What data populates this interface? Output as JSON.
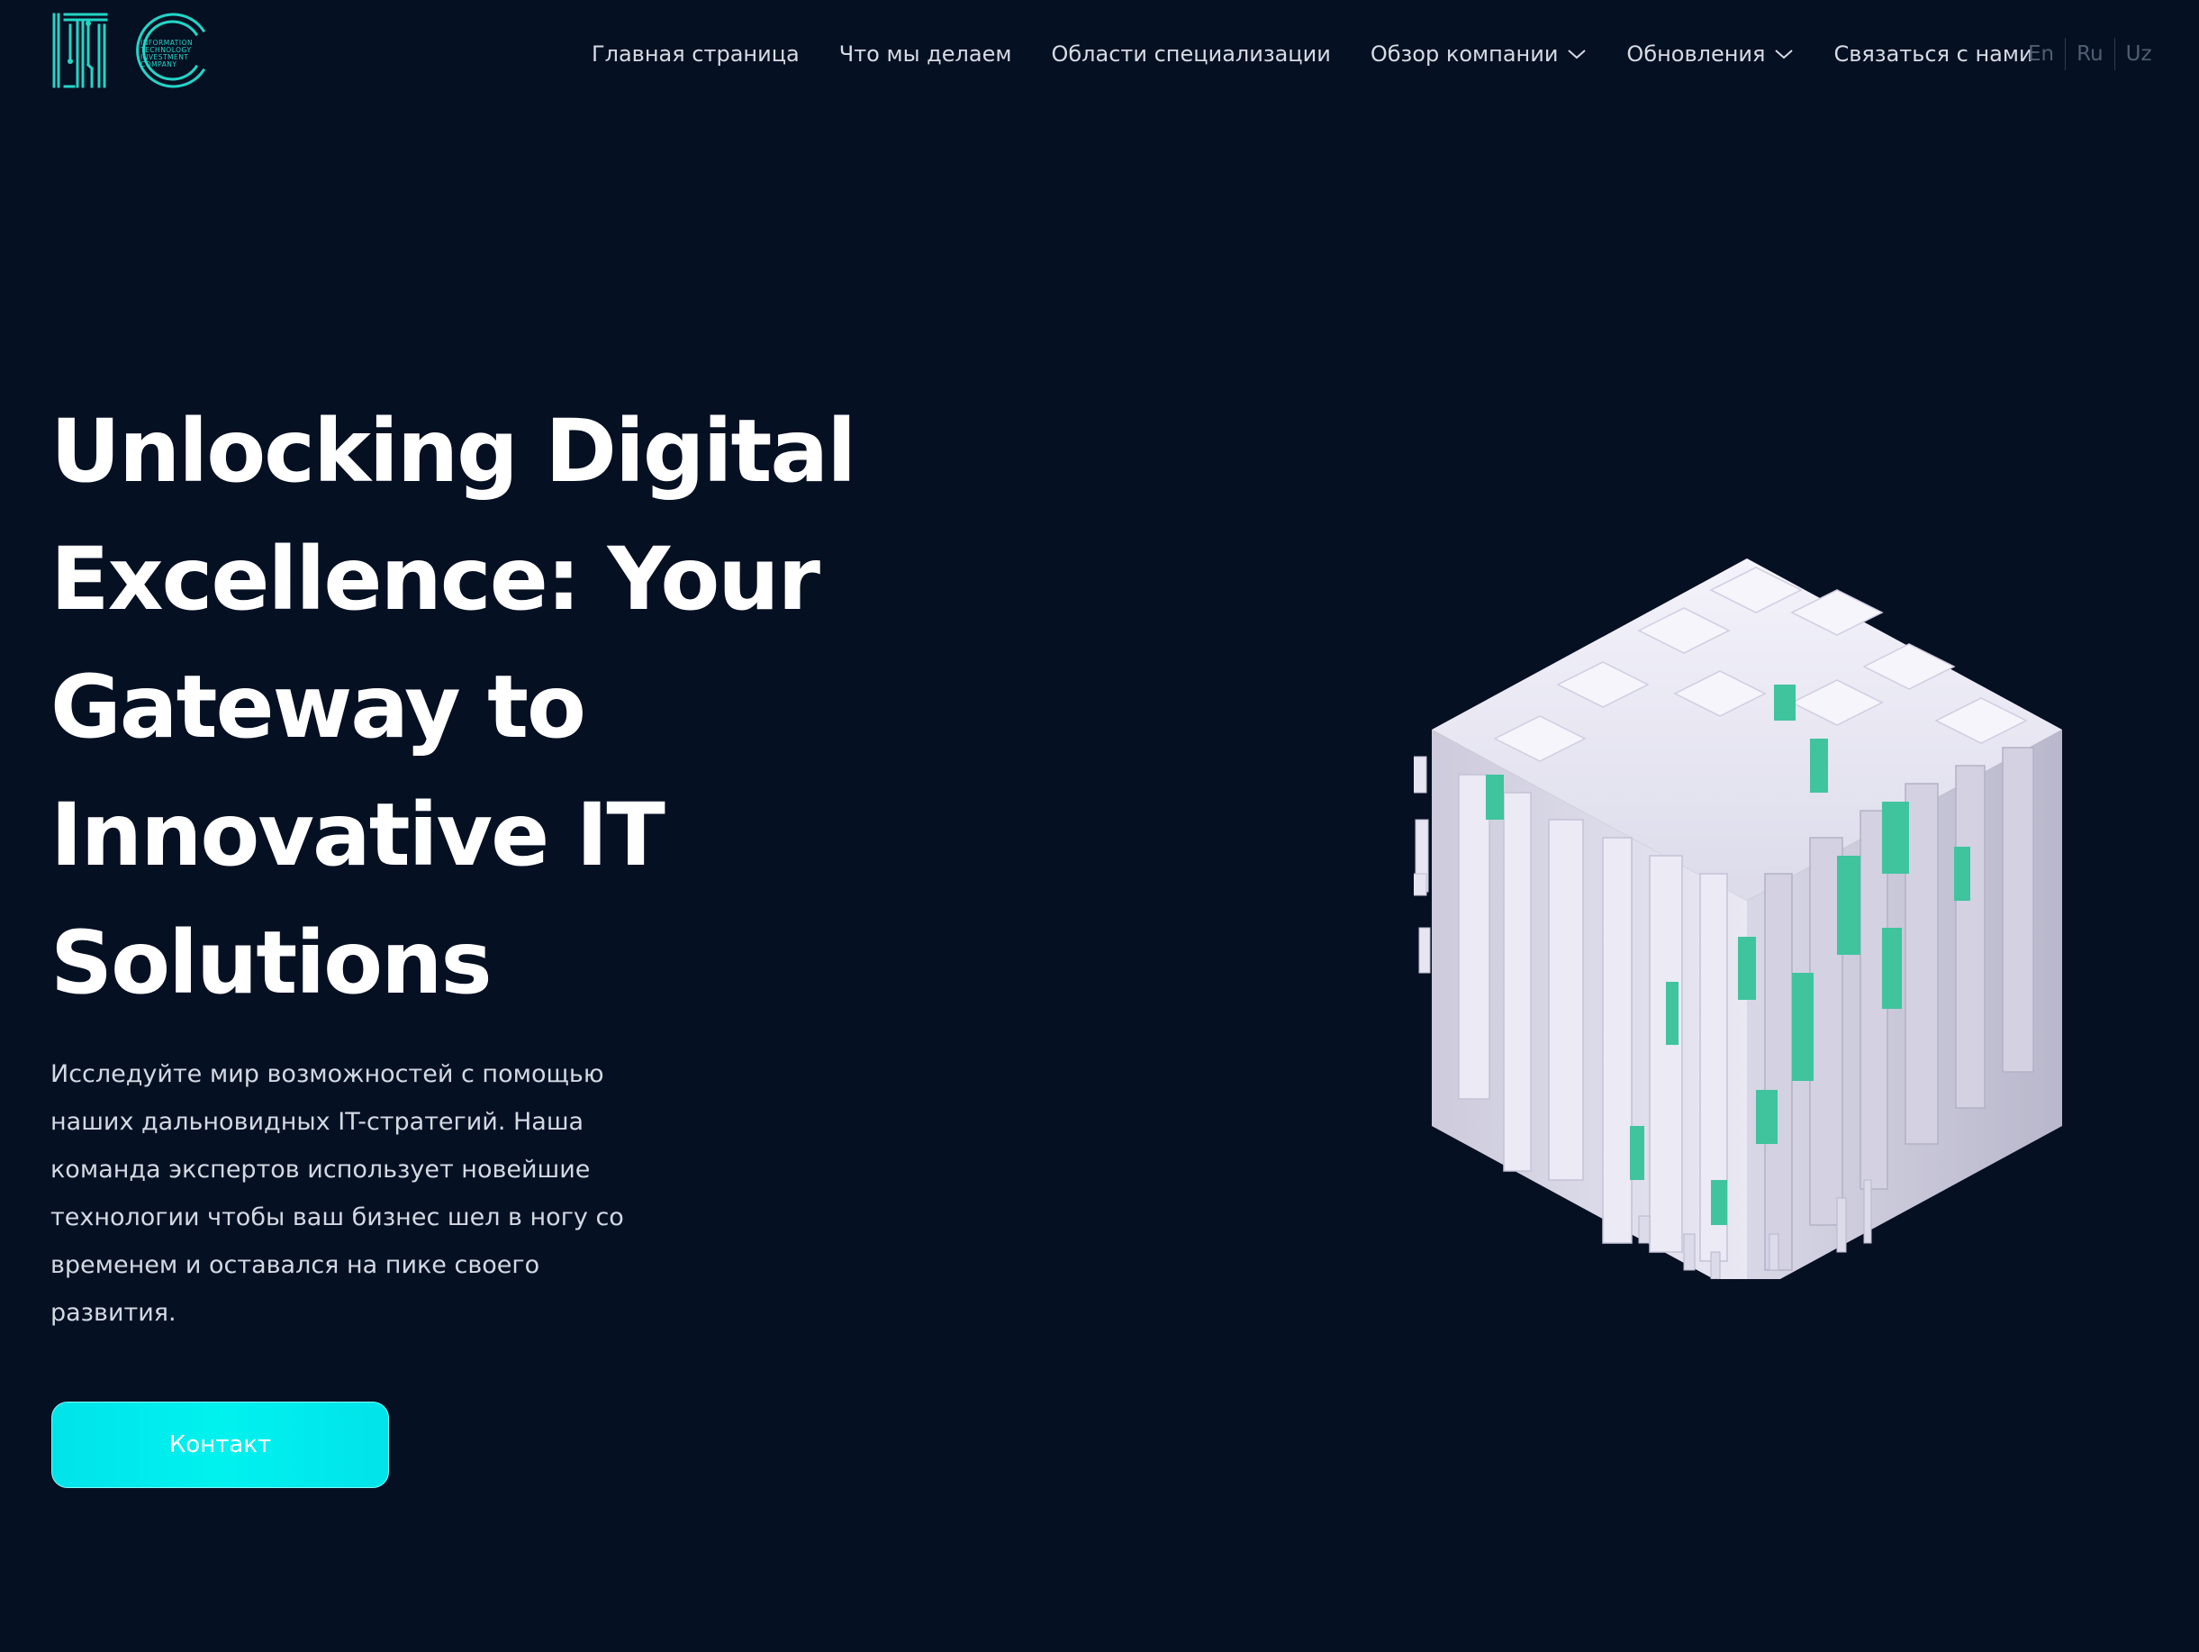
{
  "header": {
    "logo": {
      "mark": "ITIC",
      "subtitle": [
        "INFORMATION",
        "TECHNOLOGY",
        "INVESTMENT",
        "COMPANY"
      ],
      "color": "#22d5c6"
    },
    "nav": [
      {
        "label": "Главная страница",
        "dropdown": false
      },
      {
        "label": "Что мы делаем",
        "dropdown": false
      },
      {
        "label": "Области специализации",
        "dropdown": false
      },
      {
        "label": "Обзор компании",
        "dropdown": true,
        "icon": "chevron-down-icon"
      },
      {
        "label": "Обновления",
        "dropdown": true,
        "icon": "chevron-down-icon"
      },
      {
        "label": "Связаться с нами",
        "dropdown": false
      }
    ],
    "languages": [
      "En",
      "Ru",
      "Uz"
    ]
  },
  "hero": {
    "title_lines": [
      "Unlocking Digital",
      "Excellence: Your",
      "Gateway to",
      "Innovative IT",
      "Solutions"
    ],
    "description_lines": [
      "Исследуйте мир возможностей с помощью",
      "наших дальновидных IT-стратегий. Наша",
      "команда экспертов использует новейшие",
      "технологии чтобы ваш бизнес шел в ногу со",
      "временем и оставался на пике своего",
      "развития."
    ],
    "cta_label": "Контакт",
    "illustration_icon": "voxel-cube-illustration"
  },
  "colors": {
    "background": "#061023",
    "accent": "#00e8ee",
    "brand": "#22d5c6",
    "nav_text": "#d6dbe3",
    "lang_text": "#4e5f73"
  }
}
